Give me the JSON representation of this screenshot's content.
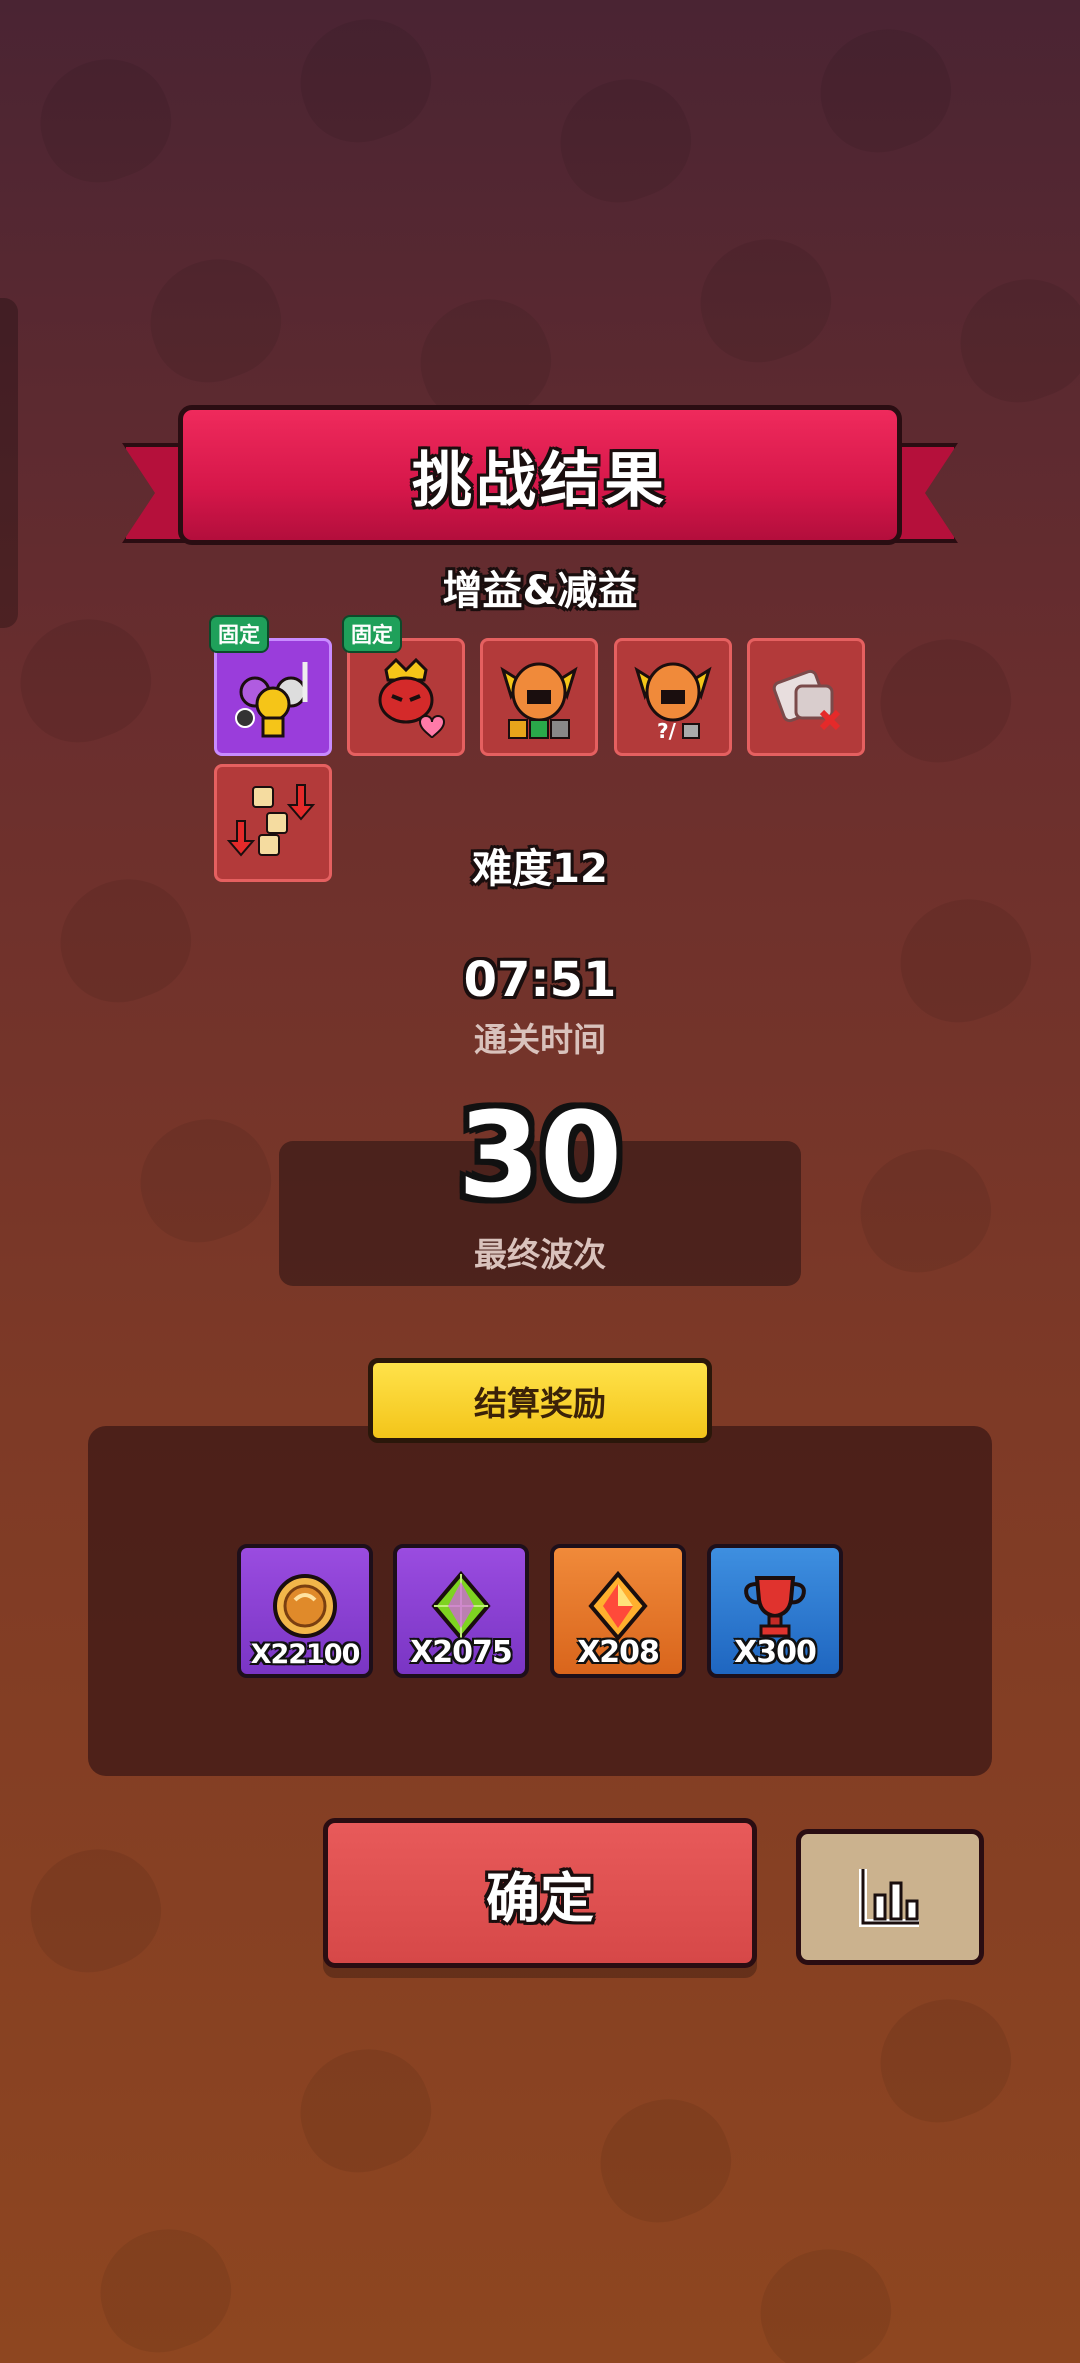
{
  "header": {
    "title": "挑战结果"
  },
  "modifiers": {
    "label": "增益&减益",
    "pin_label": "固定",
    "items": [
      {
        "icon": "hero-squad-icon",
        "pinned": true,
        "color": "#9a3ddb"
      },
      {
        "icon": "demon-heart-icon",
        "pinned": true,
        "color": "#b33a3a"
      },
      {
        "icon": "winged-helmet-skills-icon",
        "pinned": false,
        "color": "#b33a3a"
      },
      {
        "icon": "winged-helmet-locked-icon",
        "pinned": false,
        "color": "#b33a3a"
      },
      {
        "icon": "dice-cancel-icon",
        "pinned": false,
        "color": "#b33a3a"
      },
      {
        "icon": "dice-down-icon",
        "pinned": false,
        "color": "#b33a3a"
      }
    ]
  },
  "difficulty": {
    "label": "难度12"
  },
  "clear_time": {
    "value": "07:51",
    "label": "通关时间"
  },
  "final_wave": {
    "value": "30",
    "label": "最终波次"
  },
  "rewards": {
    "header": "结算奖励",
    "items": [
      {
        "icon": "coin-icon",
        "amount": "X22100",
        "color": "purple"
      },
      {
        "icon": "green-gem-icon",
        "amount": "X2075",
        "color": "purple"
      },
      {
        "icon": "orange-crystal-icon",
        "amount": "X208",
        "color": "orange"
      },
      {
        "icon": "trophy-icon",
        "amount": "X300",
        "color": "blue"
      }
    ]
  },
  "actions": {
    "confirm_label": "确定",
    "stats_icon": "bar-chart-icon"
  }
}
